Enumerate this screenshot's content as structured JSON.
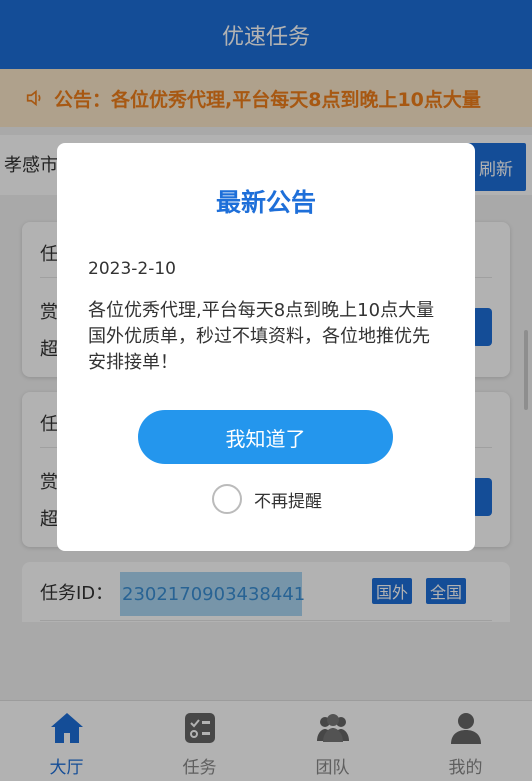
{
  "header": {
    "title": "优速任务"
  },
  "notice": {
    "text": "公告：各位优秀代理,平台每天8点到晚上10点大量"
  },
  "location": {
    "city": "孝感市",
    "refresh_label": "刷新"
  },
  "cards": [
    {
      "row1": "任",
      "row2": "赏",
      "row3": "超"
    },
    {
      "row1": "任",
      "row2": "赏",
      "row3": "超"
    }
  ],
  "task": {
    "id_label": "任务ID：",
    "id_value": "2302170903438441",
    "tags": [
      "国外",
      "全国"
    ]
  },
  "modal": {
    "title": "最新公告",
    "date": "2023-2-10",
    "body": "各位优秀代理,平台每天8点到晚上10点大量国外优质单，秒过不填资料，各位地推优先安排接单！",
    "ok_label": "我知道了",
    "remind_label": "不再提醒"
  },
  "tabs": [
    {
      "label": "大厅",
      "icon": "home-icon",
      "active": true
    },
    {
      "label": "任务",
      "icon": "task-list-icon",
      "active": false
    },
    {
      "label": "团队",
      "icon": "team-icon",
      "active": false
    },
    {
      "label": "我的",
      "icon": "user-icon",
      "active": false
    }
  ],
  "colors": {
    "primary": "#1e6fd9",
    "notice_bg": "#fbe7c9",
    "notice_text": "#ef7e1a",
    "button": "#2496ed"
  }
}
